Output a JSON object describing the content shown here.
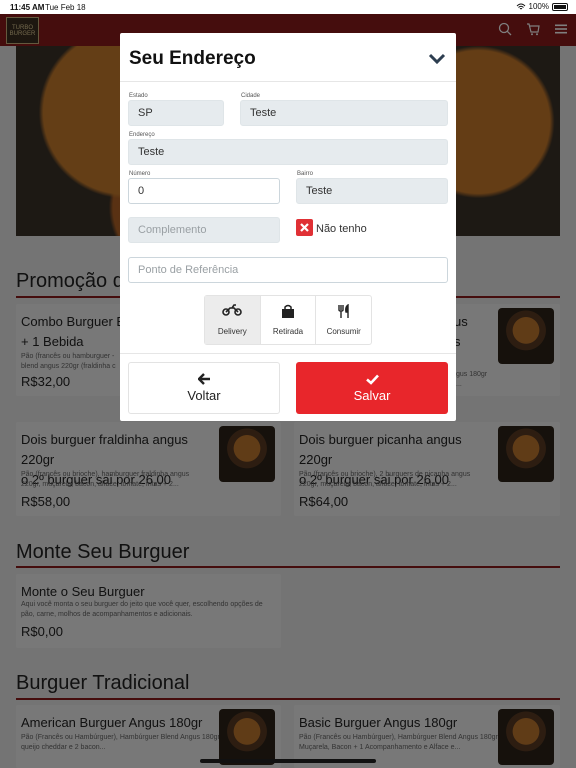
{
  "status_bar": {
    "time": "11:45 AM",
    "date": "Tue Feb 18",
    "battery": "100%"
  },
  "header": {
    "logo_text": "TURBO BURGER",
    "icons": [
      "search-icon",
      "cart-icon",
      "menu-icon"
    ]
  },
  "background": {
    "section_promo": "Promoção do",
    "promo_cards": [
      {
        "title": "Combo Burguer Bl",
        "title2": "+ 1 Bebida",
        "desc": "Pão (francês ou hamburguer -",
        "desc2": "blend angus 220gr (fraldinha c",
        "price": "R$32,00"
      },
      {
        "title": "us",
        "title2": "s",
        "desc": "gus 180gr",
        "desc2": "...",
        "price": ""
      },
      {
        "title": "Dois burguer fraldinha angus 220gr",
        "title2": "o 2º burguer sai por 26,00",
        "desc": "Pão (francês ou brioche), hamburguer fraldinha angus",
        "desc2": "220gr, muçarela, bacon, alface, tomate, fritas + 2...",
        "price": "R$58,00"
      },
      {
        "title": "Dois burguer picanha angus 220gr",
        "title2": "o 2º burguer sai por 26,00",
        "desc": "Pão (francês ou brioche), 2 burguers de picanha angus",
        "desc2": "220gr, muçarela, bacon, alface, tomate, fritas + 2...",
        "price": "R$64,00"
      }
    ],
    "section_monte": "Monte Seu Burguer",
    "monte_card": {
      "title": "Monte o Seu Burguer",
      "desc": "Aqui você monta o seu burguer do jeito que você quer, escolhendo opções de",
      "desc2": "pão, carne, molhos de acompanhamentos e adicionais.",
      "price": "R$0,00"
    },
    "section_trad": "Burguer Tradicional",
    "trad_cards": [
      {
        "title": "American Burguer Angus 180gr",
        "desc": "Pão (Francês ou Hambúrguer), Hambúrguer Blend Angus 180gr, 2 fatias",
        "desc2": "queijo cheddar e 2 bacon..."
      },
      {
        "title": "Basic Burguer Angus 180gr",
        "desc": "Pão (Francês ou Hambúrguer), Hambúrguer Blend Angus 180gr,",
        "desc2": "Muçarela, Bacon + 1 Acompanhamento e Alface e..."
      }
    ]
  },
  "modal": {
    "title": "Seu Endereço",
    "estado": {
      "label": "Estado",
      "value": "SP"
    },
    "cidade": {
      "label": "Cidade",
      "value": "Teste"
    },
    "endereco": {
      "label": "Endereço",
      "value": "Teste"
    },
    "numero": {
      "label": "Número",
      "value": "0"
    },
    "bairro": {
      "label": "Bairro",
      "value": "Teste"
    },
    "complemento": {
      "placeholder": "Complemento"
    },
    "nao_tenho": "Não tenho",
    "referencia": {
      "placeholder": "Ponto de Referência"
    },
    "modes": [
      {
        "label": "Delivery",
        "icon": "motorcycle-icon",
        "active": true
      },
      {
        "label": "Retirada",
        "icon": "shopping-bag-icon",
        "active": false
      },
      {
        "label": "Consumir",
        "icon": "cutlery-icon",
        "active": false
      }
    ],
    "voltar_label": "Voltar",
    "salvar_label": "Salvar"
  },
  "colors": {
    "brand": "#8b1a1a",
    "accent": "#e8262b"
  }
}
